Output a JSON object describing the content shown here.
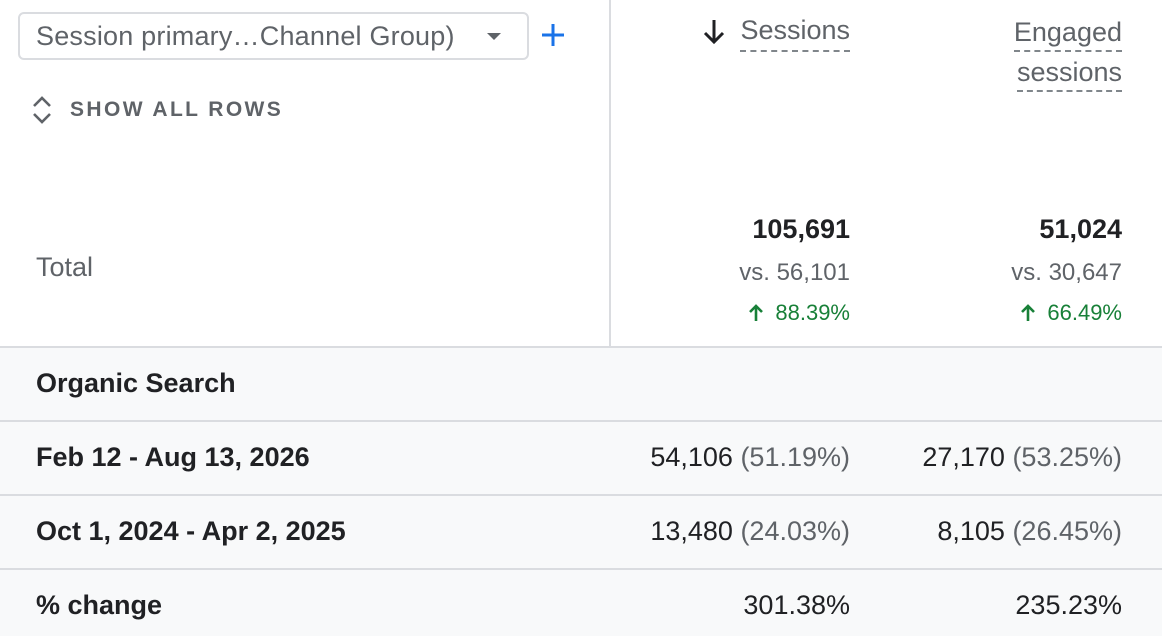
{
  "dimension_selector": {
    "label": "Session primary…Channel Group)"
  },
  "add_dimension_label": "+",
  "show_all_rows_label": "SHOW ALL ROWS",
  "columns": {
    "sessions": "Sessions",
    "engaged_line1": "Engaged",
    "engaged_line2": "sessions"
  },
  "total": {
    "label": "Total",
    "sessions": {
      "value": "105,691",
      "vs": "vs. 56,101",
      "change": "88.39%"
    },
    "engaged": {
      "value": "51,024",
      "vs": "vs. 30,647",
      "change": "66.49%"
    }
  },
  "rows": [
    {
      "label": "Organic Search",
      "sessions": "",
      "sessions_pct": "",
      "engaged": "",
      "engaged_pct": ""
    },
    {
      "label": "Feb 12 - Aug 13, 2026",
      "sessions": "54,106",
      "sessions_pct": "(51.19%)",
      "engaged": "27,170",
      "engaged_pct": "(53.25%)"
    },
    {
      "label": "Oct 1, 2024 - Apr 2, 2025",
      "sessions": "13,480",
      "sessions_pct": "(24.03%)",
      "engaged": "8,105",
      "engaged_pct": "(26.45%)"
    },
    {
      "label": "% change",
      "sessions": "301.38%",
      "sessions_pct": "",
      "engaged": "235.23%",
      "engaged_pct": ""
    }
  ],
  "colors": {
    "accent_blue": "#1a73e8",
    "positive_green": "#188038",
    "row_background": "#f8f9fa",
    "divider": "#dadce0"
  },
  "icons": {
    "add": "plus-icon",
    "dropdown": "caret-down-icon",
    "expand": "unfold-more-icon",
    "sort": "arrow-down-icon",
    "increase": "arrow-up-icon"
  }
}
